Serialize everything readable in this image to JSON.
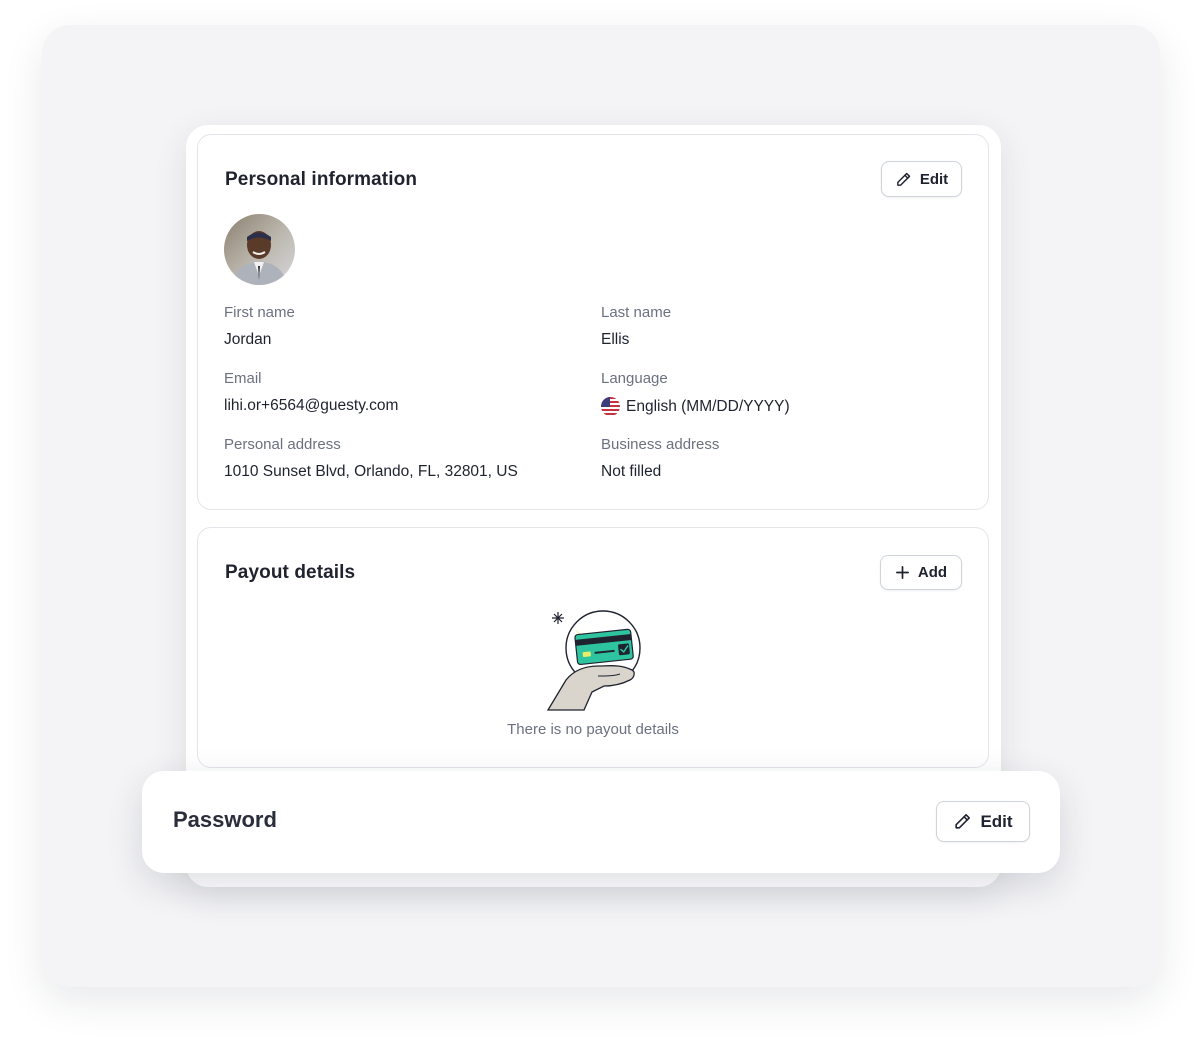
{
  "personal_info": {
    "title": "Personal information",
    "edit_label": "Edit",
    "fields": {
      "first_name": {
        "label": "First name",
        "value": "Jordan"
      },
      "last_name": {
        "label": "Last name",
        "value": "Ellis"
      },
      "email": {
        "label": "Email",
        "value": "lihi.or+6564@guesty.com"
      },
      "language": {
        "label": "Language",
        "value": "English (MM/DD/YYYY)",
        "flag": "us-flag-icon"
      },
      "personal_address": {
        "label": "Personal address",
        "value": "1010 Sunset Blvd, Orlando, FL, 32801, US"
      },
      "business_address": {
        "label": "Business address",
        "value": "Not filled"
      }
    }
  },
  "payout": {
    "title": "Payout details",
    "add_label": "Add",
    "empty_text": "There is no payout details",
    "illustration": "hand-holding-credit-card-illustration"
  },
  "password": {
    "title": "Password",
    "edit_label": "Edit"
  },
  "colors": {
    "backdrop": "#f4f4f6",
    "card_border": "#e3e5ea",
    "text_primary": "#1f2330",
    "text_secondary": "#6b7180",
    "card_green": "#2ec4a0"
  }
}
